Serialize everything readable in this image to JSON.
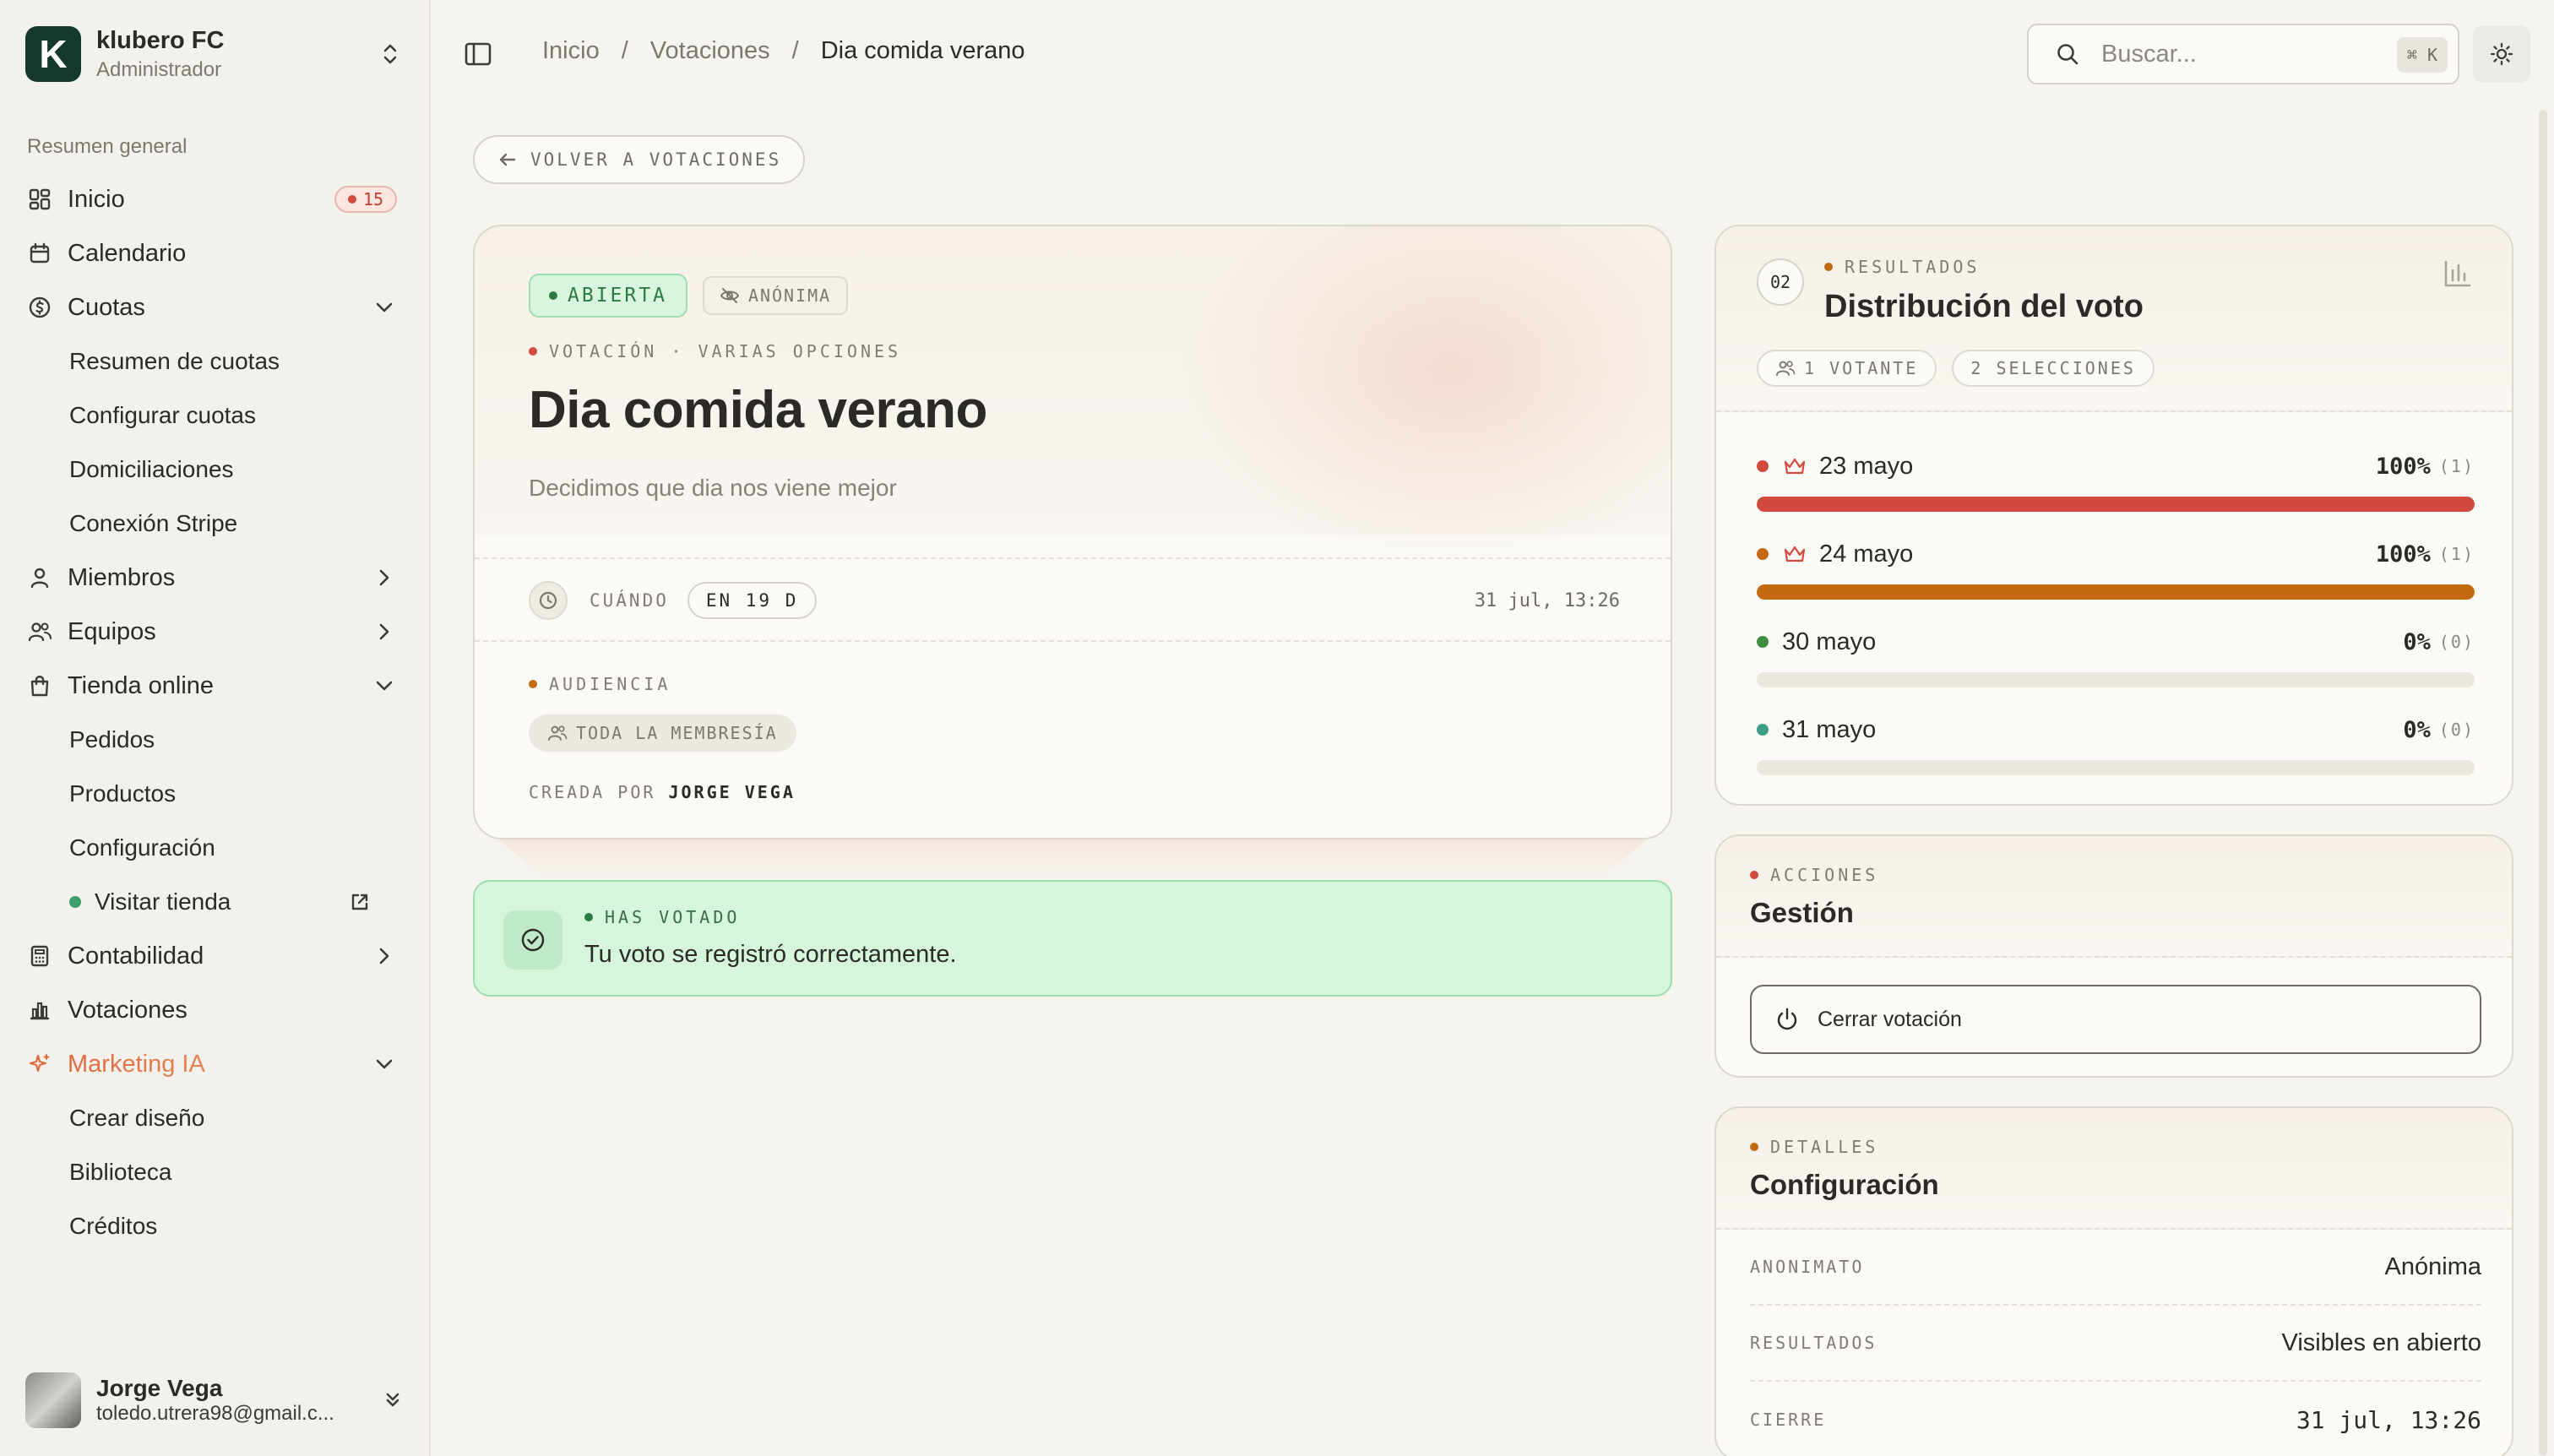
{
  "org": {
    "initial": "K",
    "name": "klubero FC",
    "role": "Administrador"
  },
  "sidebar": {
    "section_label": "Resumen general",
    "items": {
      "inicio": {
        "label": "Inicio",
        "badge": "15"
      },
      "calendario": {
        "label": "Calendario"
      },
      "cuotas": {
        "label": "Cuotas",
        "children": [
          "Resumen de cuotas",
          "Configurar cuotas",
          "Domiciliaciones",
          "Conexión Stripe"
        ]
      },
      "miembros": {
        "label": "Miembros"
      },
      "equipos": {
        "label": "Equipos"
      },
      "tienda": {
        "label": "Tienda online",
        "children": [
          "Pedidos",
          "Productos",
          "Configuración"
        ],
        "visit": "Visitar tienda"
      },
      "contabilidad": {
        "label": "Contabilidad"
      },
      "votaciones": {
        "label": "Votaciones"
      },
      "marketing": {
        "label": "Marketing IA",
        "children": [
          "Crear diseño",
          "Biblioteca",
          "Créditos"
        ]
      }
    }
  },
  "user": {
    "name": "Jorge Vega",
    "email": "toledo.utrera98@gmail.c..."
  },
  "topbar": {
    "breadcrumb": [
      "Inicio",
      "Votaciones",
      "Dia comida verano"
    ],
    "separator": "/",
    "search_placeholder": "Buscar...",
    "shortcut": "⌘ K"
  },
  "back_label": "VOLVER A VOTACIONES",
  "vote": {
    "status": "ABIERTA",
    "privacy": "ANÓNIMA",
    "kicker": "VOTACIÓN · VARIAS OPCIONES",
    "title": "Dia comida verano",
    "description": "Decidimos que dia nos viene mejor",
    "when_label": "CUÁNDO",
    "when_relative": "EN 19 D",
    "when_date": "31 jul, 13:26",
    "audience_label": "AUDIENCIA",
    "audience": "TODA LA MEMBRESÍA",
    "created_prefix": "CREADA POR",
    "created_by": "JORGE VEGA"
  },
  "voted": {
    "kicker": "HAS VOTADO",
    "message": "Tu voto se registró correctamente."
  },
  "results": {
    "number": "02",
    "kicker": "RESULTADOS",
    "title": "Distribución del voto",
    "voters": "1 VOTANTE",
    "selections": "2 SELECCIONES",
    "options": [
      {
        "label": "23 mayo",
        "pct": "100%",
        "count": "(1)",
        "value": 1.0,
        "color": "#d04a3e",
        "winner": true
      },
      {
        "label": "24 mayo",
        "pct": "100%",
        "count": "(1)",
        "value": 1.0,
        "color": "#c36a10",
        "winner": true
      },
      {
        "label": "30 mayo",
        "pct": "0%",
        "count": "(0)",
        "value": 0.0,
        "color": "#3f8f3f",
        "winner": false
      },
      {
        "label": "31 mayo",
        "pct": "0%",
        "count": "(0)",
        "value": 0.0,
        "color": "#3f9f86",
        "winner": false
      }
    ]
  },
  "actions": {
    "kicker": "ACCIONES",
    "title": "Gestión",
    "close_label": "Cerrar votación"
  },
  "details": {
    "kicker": "DETALLES",
    "title": "Configuración",
    "rows": [
      {
        "key": "ANONIMATO",
        "value": "Anónima"
      },
      {
        "key": "RESULTADOS",
        "value": "Visibles en abierto"
      },
      {
        "key": "CIERRE",
        "value": "31 jul, 13:26"
      }
    ]
  },
  "colors": {
    "accent_red": "#d04a3e",
    "accent_orange": "#c36a10",
    "success_green": "#d6f6dc",
    "brand_dark": "#15382e"
  }
}
